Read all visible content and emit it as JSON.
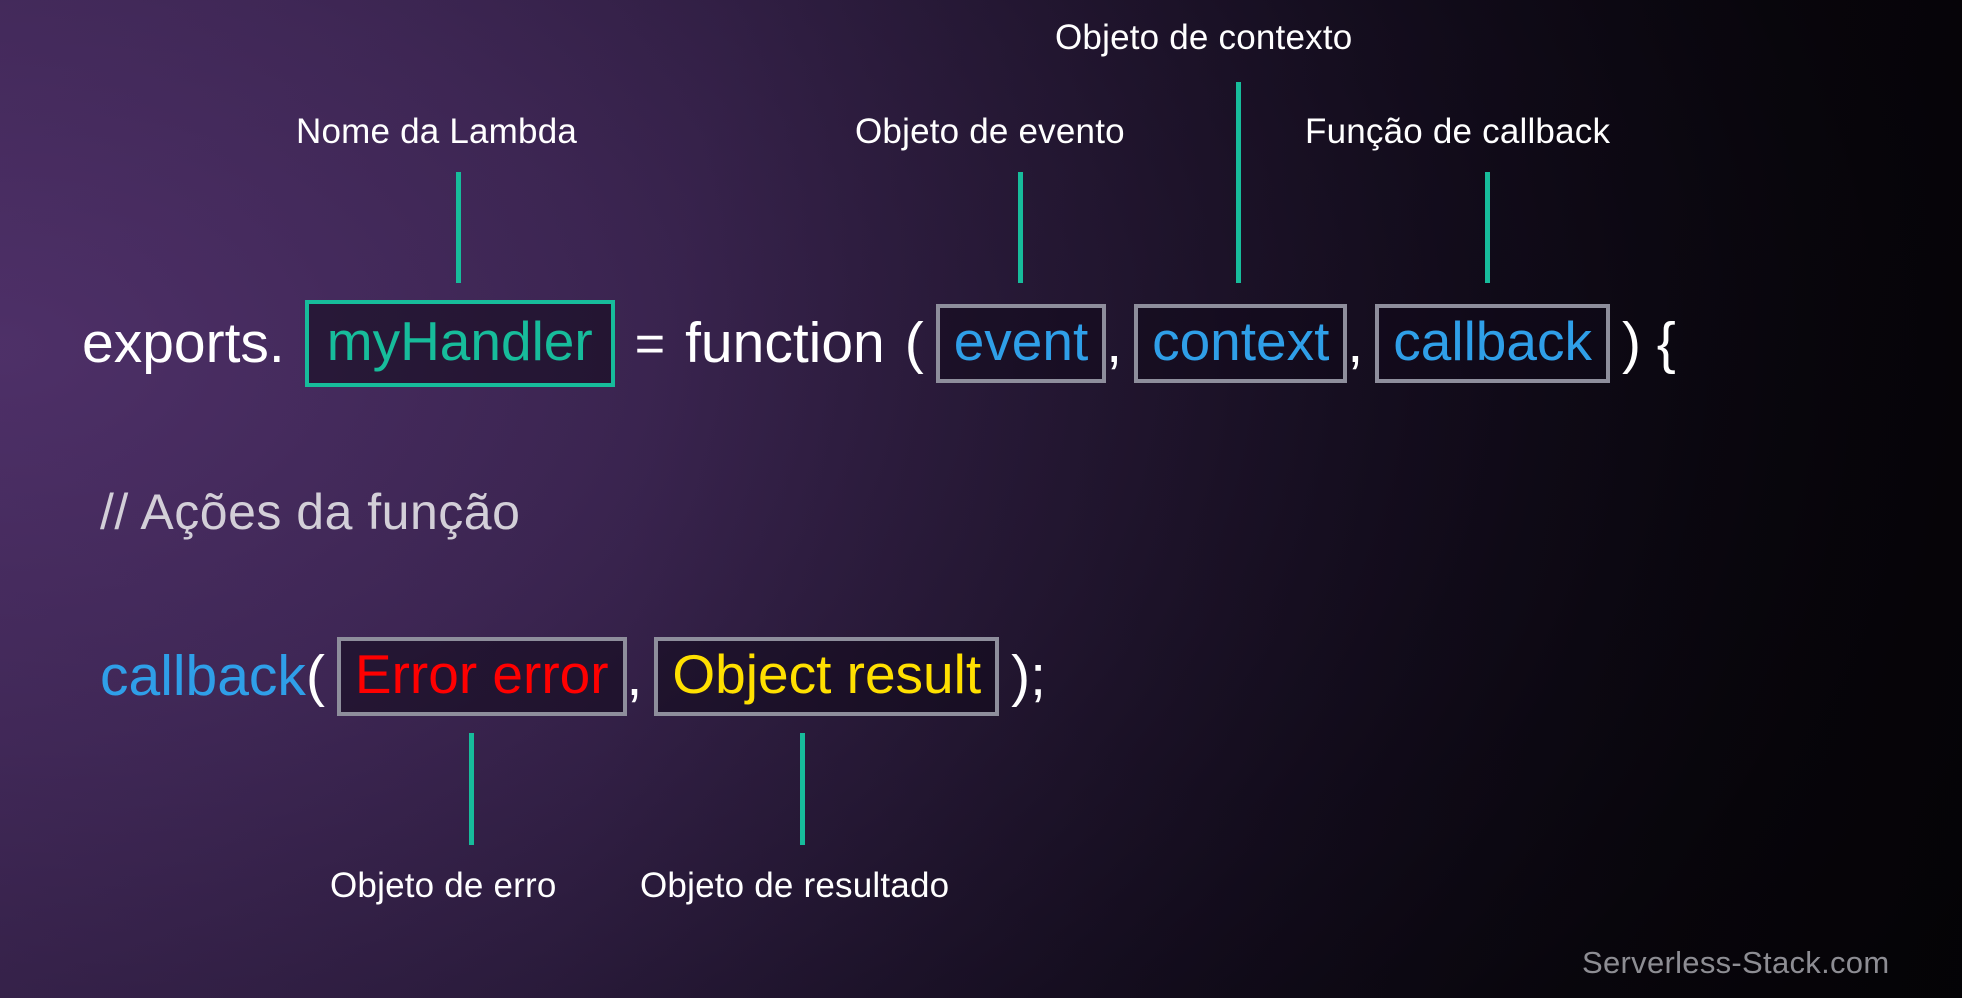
{
  "diagram": {
    "title_context": "Objeto de contexto",
    "annotations": {
      "lambda_name": "Nome da Lambda",
      "event_object": "Objeto de evento",
      "context_object": "Objeto de contexto",
      "callback_function": "Função de callback",
      "error_object": "Objeto de erro",
      "result_object": "Objeto de resultado"
    },
    "code": {
      "line1": {
        "prefix": "exports.",
        "handler_name": "myHandler",
        "equals": "=",
        "keyword": "function",
        "open_paren": "(",
        "param_event": "event",
        "comma1": ",",
        "param_context": "context",
        "comma2": ",",
        "param_callback": "callback",
        "close": ") {"
      },
      "comment": "// Ações da função",
      "line3": {
        "callee": "callback",
        "open_paren": "(",
        "arg_error": "Error error",
        "comma": ",",
        "arg_result": "Object result",
        "close": ");"
      }
    },
    "watermark": "Serverless-Stack.com",
    "colors": {
      "accent_teal": "#17bc9b",
      "param_blue": "#2f9fe8",
      "error_red": "#ff0000",
      "result_yellow": "#ffe000",
      "box_border_gray": "#8e8e9c",
      "comment_gray": "#d3cfd8",
      "watermark_gray": "#8d8d93",
      "background_purple": "#4e3068",
      "background_dark": "#070509"
    }
  }
}
